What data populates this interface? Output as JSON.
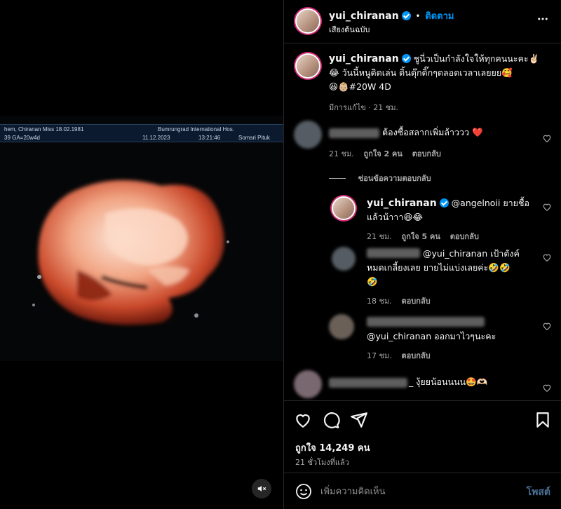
{
  "media": {
    "ultrasound_header": {
      "patient": "hem, Chiranan  Miss 18.02.1981",
      "hospital": "Bumrungrad International Hos.",
      "ga": "39  GA=20w4d",
      "date": "11.12.2023",
      "time": "13:21:46",
      "operator": "Somsri Pituk"
    },
    "mute_icon": "speaker-muted-icon"
  },
  "header": {
    "username": "yui_chiranan",
    "dot": "•",
    "follow_label": "ติดตาม",
    "audio_label": "เสียงต้นฉบับ",
    "more_icon": "more-horizontal-icon"
  },
  "caption": {
    "username": "yui_chiranan",
    "text_line1": "ชูนี่วเป็นกำลังใจให้ทุกคนนะคะ✌🏻",
    "text_line2": "😂 วันนี้หนูดิดเล่น ดิ้นดุ๊กดิ๊กๆตลอดเวลาเลยยย🥰",
    "text_line3": "😆👶🏼#20W 4D",
    "meta": "มีการแก้ไข · 21 ชม."
  },
  "comments": [
    {
      "text": "ต้องซื้อสลากเพิ่มล้าววว ❤️",
      "time": "21 ชม.",
      "likes": "ถูกใจ 2 คน",
      "reply_label": "ตอบกลับ"
    }
  ],
  "hide_replies_label": "ซ่อนข้อความตอบกลับ",
  "replies": [
    {
      "username": "yui_chiranan",
      "text_line1": "@angelnoii ยายชื้อ",
      "text_line2": "แล้วน้าาา😆😂",
      "time": "21 ชม.",
      "likes": "ถูกใจ 5 คน",
      "reply_label": "ตอบกลับ"
    },
    {
      "text_line1": "@yui_chiranan เป้าตังค์",
      "text_line2": "หมดเกลี้ยงเลย ยายไม่แบ่งเลยค่ะ🤣🤣",
      "text_line3": "🤣",
      "time": "18 ชม.",
      "reply_label": "ตอบกลับ"
    },
    {
      "text": "@yui_chiranan ออกมาไวๆนะคะ",
      "time": "17 ชม.",
      "reply_label": "ตอบกลับ"
    }
  ],
  "last_comment": {
    "text": "_ งุ้ยยน้อนนนน🤩🫶🏻"
  },
  "actions": {
    "like_icon": "heart-icon",
    "comment_icon": "comment-icon",
    "share_icon": "share-icon",
    "save_icon": "bookmark-icon",
    "likes": "ถูกใจ 14,249 คน",
    "time_ago": "21 ชั่วโมงที่แล้ว"
  },
  "comment_box": {
    "emoji_icon": "emoji-icon",
    "placeholder": "เพิ่มความคิดเห็น",
    "post_label": "โพสต์"
  },
  "colors": {
    "accent": "#0095f6",
    "background": "#000000",
    "like_red": "#ff3040"
  }
}
